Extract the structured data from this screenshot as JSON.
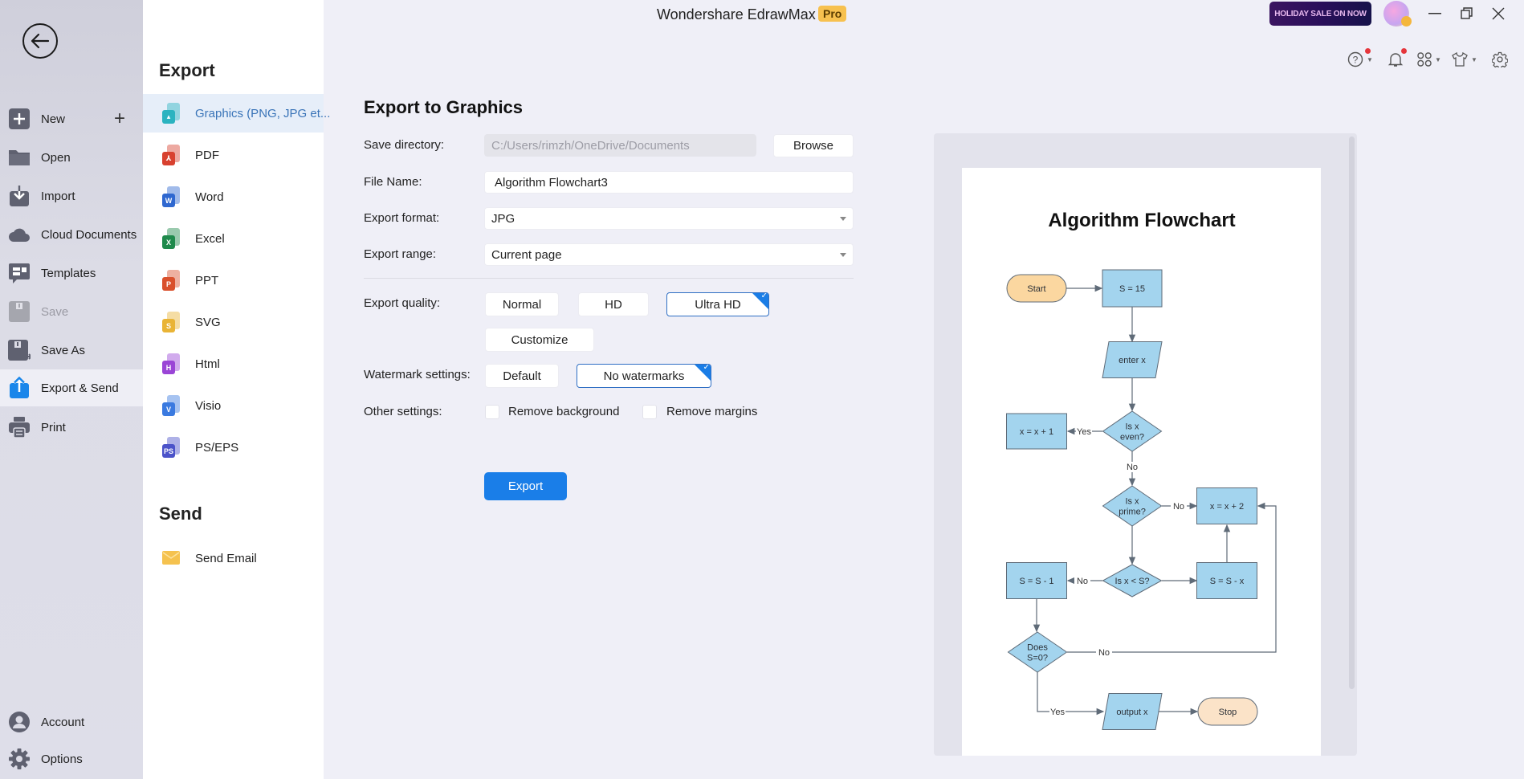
{
  "app": {
    "title": "Wondershare EdrawMax",
    "badge": "Pro",
    "promo": "HOLIDAY SALE ON NOW"
  },
  "window_controls": {
    "minimize": "—",
    "restore": "❐",
    "close": "✕"
  },
  "toolbar_icons": [
    "help-icon",
    "bell-icon",
    "apps-grid-icon",
    "shirt-theme-icon",
    "gear-icon"
  ],
  "nav": {
    "items": [
      {
        "label": "New",
        "icon": "new-plus-icon"
      },
      {
        "label": "Open",
        "icon": "folder-icon"
      },
      {
        "label": "Import",
        "icon": "import-icon"
      },
      {
        "label": "Cloud Documents",
        "icon": "cloud-icon"
      },
      {
        "label": "Templates",
        "icon": "templates-icon"
      },
      {
        "label": "Save",
        "icon": "save-icon",
        "disabled": true
      },
      {
        "label": "Save As",
        "icon": "save-as-icon"
      },
      {
        "label": "Export & Send",
        "icon": "export-icon",
        "active": true
      },
      {
        "label": "Print",
        "icon": "print-icon"
      }
    ],
    "bottom": [
      {
        "label": "Account",
        "icon": "account-icon"
      },
      {
        "label": "Options",
        "icon": "gear-icon"
      }
    ]
  },
  "export_panel": {
    "export_heading": "Export",
    "send_heading": "Send",
    "formats": [
      {
        "label": "Graphics (PNG, JPG et...",
        "letter": "",
        "color": "#2bb3c0",
        "active": true
      },
      {
        "label": "PDF",
        "letter": "⅄",
        "color": "#d8412f"
      },
      {
        "label": "Word",
        "letter": "W",
        "color": "#2f68d0"
      },
      {
        "label": "Excel",
        "letter": "X",
        "color": "#1f8a4c"
      },
      {
        "label": "PPT",
        "letter": "P",
        "color": "#d9502c"
      },
      {
        "label": "SVG",
        "letter": "S",
        "color": "#e9b436"
      },
      {
        "label": "Html",
        "letter": "H",
        "color": "#9a45d6"
      },
      {
        "label": "Visio",
        "letter": "V",
        "color": "#3a7ae0"
      },
      {
        "label": "PS/EPS",
        "letter": "PS",
        "color": "#4b53c9"
      }
    ],
    "send_items": [
      {
        "label": "Send Email",
        "color": "#f5c24f"
      }
    ]
  },
  "form": {
    "title": "Export to Graphics",
    "save_directory": {
      "label": "Save directory:",
      "value": "C:/Users/rimzh/OneDrive/Documents",
      "browse": "Browse"
    },
    "file_name": {
      "label": "File Name:",
      "value": "Algorithm Flowchart3"
    },
    "export_format": {
      "label": "Export format:",
      "value": "JPG"
    },
    "export_range": {
      "label": "Export range:",
      "value": "Current page"
    },
    "export_quality": {
      "label": "Export quality:",
      "options": [
        "Normal",
        "HD",
        "Ultra HD",
        "Customize"
      ],
      "selected": "Ultra HD"
    },
    "watermark": {
      "label": "Watermark settings:",
      "options": [
        "Default",
        "No watermarks"
      ],
      "selected": "No watermarks"
    },
    "other": {
      "label": "Other settings:",
      "remove_background": {
        "label": "Remove background",
        "checked": false
      },
      "remove_margins": {
        "label": "Remove margins",
        "checked": false
      }
    },
    "export_button": "Export"
  },
  "preview": {
    "title": "Algorithm Flowchart",
    "colors": {
      "process": "#a3d4ee",
      "terminal_start": "#fbd7a0",
      "terminal_stop": "#fbe3c8",
      "stroke": "#5f6b78"
    },
    "nodes": [
      {
        "id": "start",
        "type": "terminal",
        "text": "Start"
      },
      {
        "id": "s15",
        "type": "process",
        "text": "S = 15"
      },
      {
        "id": "enter",
        "type": "io",
        "text": "enter x"
      },
      {
        "id": "even",
        "type": "decision",
        "text": [
          "Is x",
          "even?"
        ]
      },
      {
        "id": "xp1",
        "type": "process",
        "text": "x = x + 1"
      },
      {
        "id": "prime",
        "type": "decision",
        "text": [
          "Is x",
          "prime?"
        ]
      },
      {
        "id": "xp2",
        "type": "process",
        "text": "x = x + 2"
      },
      {
        "id": "lessS",
        "type": "decision",
        "text": [
          "Is x < S?"
        ]
      },
      {
        "id": "sm1",
        "type": "process",
        "text": "S = S - 1"
      },
      {
        "id": "smx",
        "type": "process",
        "text": "S = S - x"
      },
      {
        "id": "zero",
        "type": "decision",
        "text": [
          "Does",
          "S=0?"
        ]
      },
      {
        "id": "out",
        "type": "io",
        "text": "output x"
      },
      {
        "id": "stop",
        "type": "terminal",
        "text": "Stop"
      }
    ],
    "edge_labels": {
      "even_yes": "Yes",
      "even_no": "No",
      "prime_no": "No",
      "less_no": "No",
      "zero_no": "No",
      "zero_yes": "Yes"
    }
  }
}
